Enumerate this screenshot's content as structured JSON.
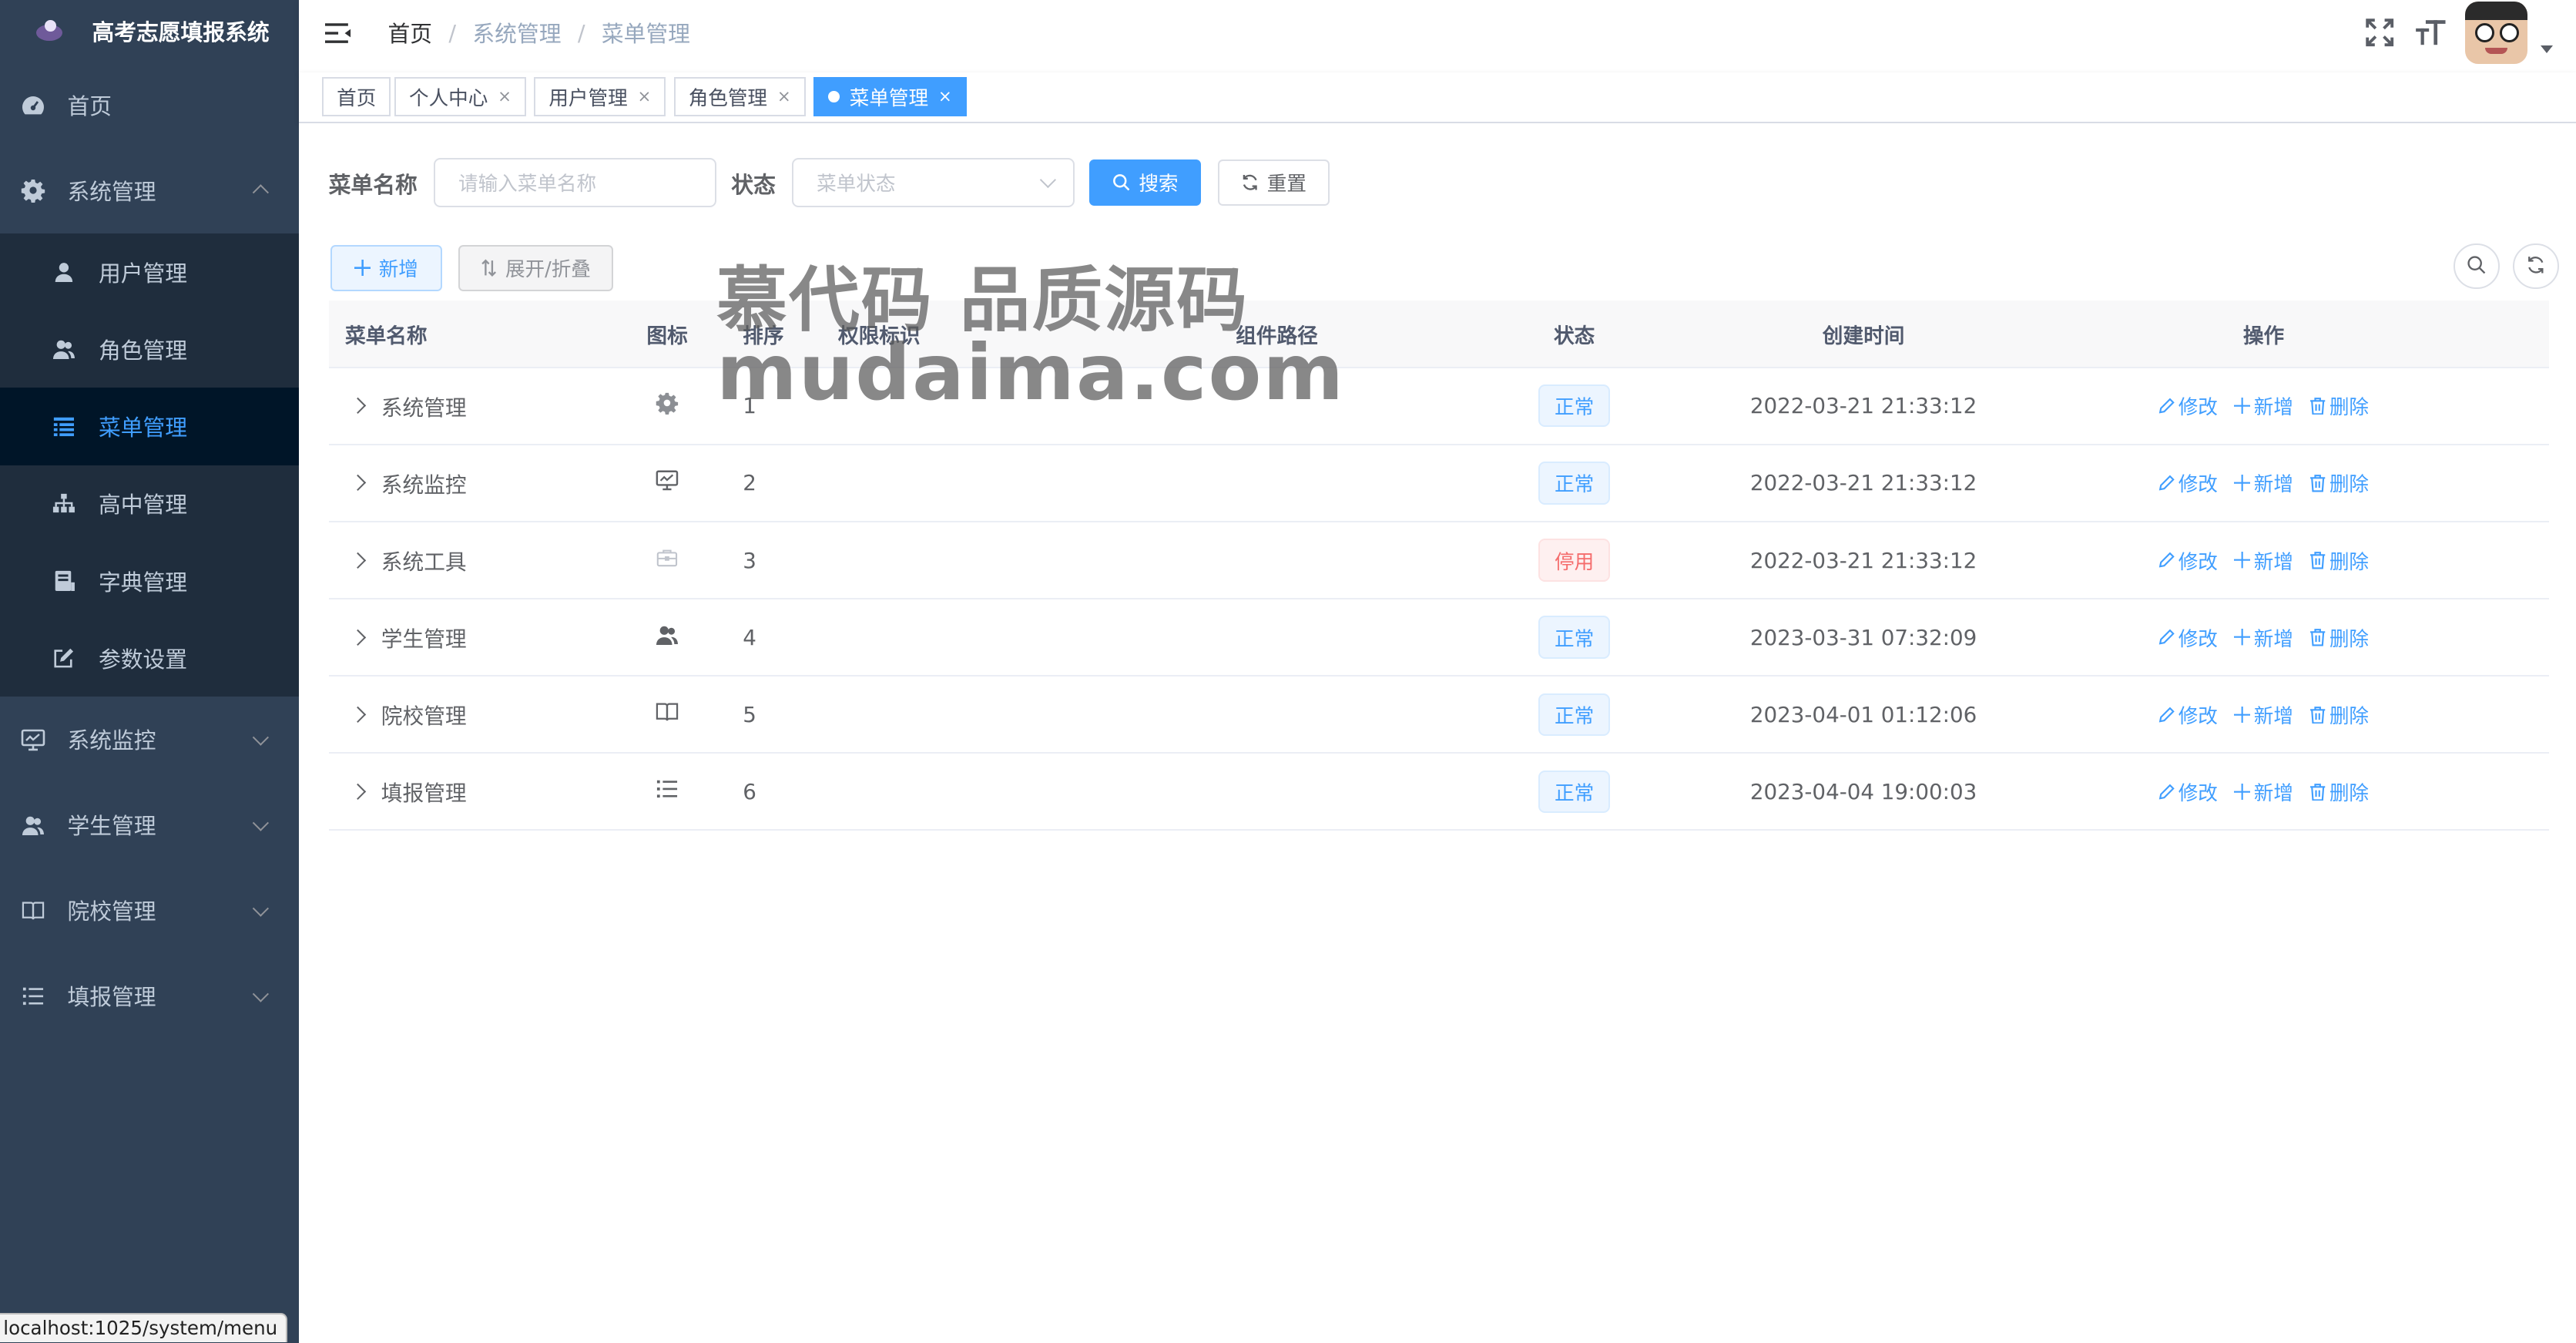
{
  "app": {
    "title": "高考志愿填报系统"
  },
  "sidebar": {
    "items": [
      {
        "label": "首页",
        "icon": "dashboard-icon"
      },
      {
        "label": "系统管理",
        "icon": "gear-icon",
        "expanded": true,
        "children": [
          {
            "label": "用户管理",
            "icon": "user-icon"
          },
          {
            "label": "角色管理",
            "icon": "peoples-icon"
          },
          {
            "label": "菜单管理",
            "icon": "tree-table-icon",
            "active": true
          },
          {
            "label": "高中管理",
            "icon": "tree-icon"
          },
          {
            "label": "字典管理",
            "icon": "dict-icon"
          },
          {
            "label": "参数设置",
            "icon": "edit-icon"
          }
        ]
      },
      {
        "label": "系统监控",
        "icon": "monitor-icon"
      },
      {
        "label": "学生管理",
        "icon": "peoples-icon"
      },
      {
        "label": "院校管理",
        "icon": "book-icon"
      },
      {
        "label": "填报管理",
        "icon": "list-icon"
      }
    ]
  },
  "breadcrumb": {
    "home": "首页",
    "sep": "/",
    "level1": "系统管理",
    "level2": "菜单管理"
  },
  "tags": [
    {
      "label": "首页",
      "closable": false
    },
    {
      "label": "个人中心",
      "closable": true
    },
    {
      "label": "用户管理",
      "closable": true
    },
    {
      "label": "角色管理",
      "closable": true
    },
    {
      "label": "菜单管理",
      "closable": true,
      "active": true
    }
  ],
  "tag_close": "×",
  "search": {
    "name_label": "菜单名称",
    "name_placeholder": "请输入菜单名称",
    "status_label": "状态",
    "status_placeholder": "菜单状态",
    "search_button": "搜索",
    "reset_button": "重置"
  },
  "toolbar": {
    "add_button": "新增",
    "expand_button": "展开/折叠"
  },
  "table": {
    "columns": [
      "菜单名称",
      "图标",
      "排序",
      "权限标识",
      "组件路径",
      "状态",
      "创建时间",
      "操作"
    ],
    "rows": [
      {
        "name": "系统管理",
        "icon": "gear-icon",
        "order": "1",
        "perm": "",
        "component": "",
        "status": "正常",
        "status_type": "ok",
        "time": "2022-03-21 21:33:12"
      },
      {
        "name": "系统监控",
        "icon": "monitor-icon",
        "order": "2",
        "perm": "",
        "component": "",
        "status": "正常",
        "status_type": "ok",
        "time": "2022-03-21 21:33:12"
      },
      {
        "name": "系统工具",
        "icon": "tool-icon",
        "order": "3",
        "perm": "",
        "component": "",
        "status": "停用",
        "status_type": "off",
        "time": "2022-03-21 21:33:12"
      },
      {
        "name": "学生管理",
        "icon": "peoples-icon",
        "order": "4",
        "perm": "",
        "component": "",
        "status": "正常",
        "status_type": "ok",
        "time": "2023-03-31 07:32:09"
      },
      {
        "name": "院校管理",
        "icon": "book-icon",
        "order": "5",
        "perm": "",
        "component": "",
        "status": "正常",
        "status_type": "ok",
        "time": "2023-04-01 01:12:06"
      },
      {
        "name": "填报管理",
        "icon": "list-icon",
        "order": "6",
        "perm": "",
        "component": "",
        "status": "正常",
        "status_type": "ok",
        "time": "2023-04-04 19:00:03"
      }
    ],
    "ops": {
      "edit": "修改",
      "add": "新增",
      "delete": "删除"
    }
  },
  "watermark": {
    "line1": "慕代码 品质源码",
    "line2": "mudaima.com"
  },
  "statusbar": {
    "url": "localhost:1025/system/menu"
  },
  "colors": {
    "sidebar_bg": "#304156",
    "submenu_bg": "#1f2d3d",
    "active_bg": "#001528",
    "primary": "#409eff",
    "danger": "#f56c6c"
  }
}
